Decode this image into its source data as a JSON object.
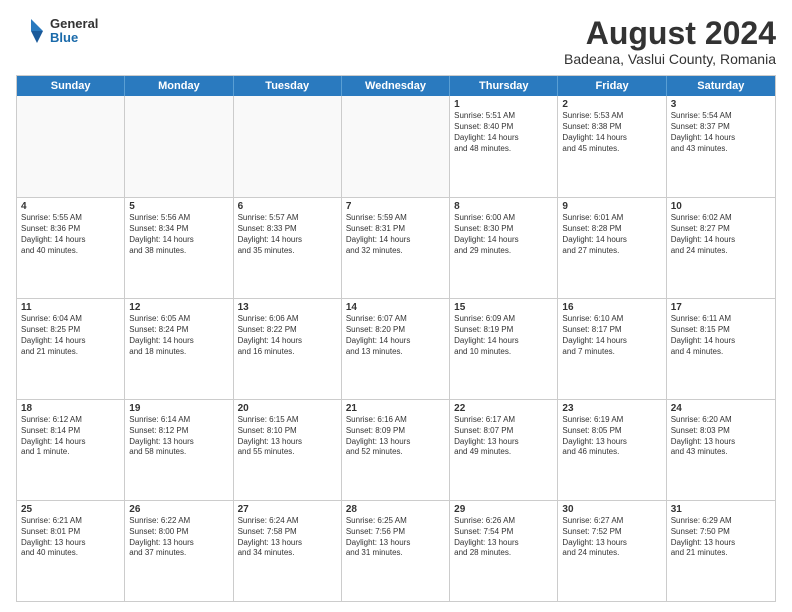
{
  "logo": {
    "general": "General",
    "blue": "Blue"
  },
  "title": "August 2024",
  "subtitle": "Badeana, Vaslui County, Romania",
  "header_days": [
    "Sunday",
    "Monday",
    "Tuesday",
    "Wednesday",
    "Thursday",
    "Friday",
    "Saturday"
  ],
  "weeks": [
    [
      {
        "day": "",
        "text": ""
      },
      {
        "day": "",
        "text": ""
      },
      {
        "day": "",
        "text": ""
      },
      {
        "day": "",
        "text": ""
      },
      {
        "day": "1",
        "text": "Sunrise: 5:51 AM\nSunset: 8:40 PM\nDaylight: 14 hours\nand 48 minutes."
      },
      {
        "day": "2",
        "text": "Sunrise: 5:53 AM\nSunset: 8:38 PM\nDaylight: 14 hours\nand 45 minutes."
      },
      {
        "day": "3",
        "text": "Sunrise: 5:54 AM\nSunset: 8:37 PM\nDaylight: 14 hours\nand 43 minutes."
      }
    ],
    [
      {
        "day": "4",
        "text": "Sunrise: 5:55 AM\nSunset: 8:36 PM\nDaylight: 14 hours\nand 40 minutes."
      },
      {
        "day": "5",
        "text": "Sunrise: 5:56 AM\nSunset: 8:34 PM\nDaylight: 14 hours\nand 38 minutes."
      },
      {
        "day": "6",
        "text": "Sunrise: 5:57 AM\nSunset: 8:33 PM\nDaylight: 14 hours\nand 35 minutes."
      },
      {
        "day": "7",
        "text": "Sunrise: 5:59 AM\nSunset: 8:31 PM\nDaylight: 14 hours\nand 32 minutes."
      },
      {
        "day": "8",
        "text": "Sunrise: 6:00 AM\nSunset: 8:30 PM\nDaylight: 14 hours\nand 29 minutes."
      },
      {
        "day": "9",
        "text": "Sunrise: 6:01 AM\nSunset: 8:28 PM\nDaylight: 14 hours\nand 27 minutes."
      },
      {
        "day": "10",
        "text": "Sunrise: 6:02 AM\nSunset: 8:27 PM\nDaylight: 14 hours\nand 24 minutes."
      }
    ],
    [
      {
        "day": "11",
        "text": "Sunrise: 6:04 AM\nSunset: 8:25 PM\nDaylight: 14 hours\nand 21 minutes."
      },
      {
        "day": "12",
        "text": "Sunrise: 6:05 AM\nSunset: 8:24 PM\nDaylight: 14 hours\nand 18 minutes."
      },
      {
        "day": "13",
        "text": "Sunrise: 6:06 AM\nSunset: 8:22 PM\nDaylight: 14 hours\nand 16 minutes."
      },
      {
        "day": "14",
        "text": "Sunrise: 6:07 AM\nSunset: 8:20 PM\nDaylight: 14 hours\nand 13 minutes."
      },
      {
        "day": "15",
        "text": "Sunrise: 6:09 AM\nSunset: 8:19 PM\nDaylight: 14 hours\nand 10 minutes."
      },
      {
        "day": "16",
        "text": "Sunrise: 6:10 AM\nSunset: 8:17 PM\nDaylight: 14 hours\nand 7 minutes."
      },
      {
        "day": "17",
        "text": "Sunrise: 6:11 AM\nSunset: 8:15 PM\nDaylight: 14 hours\nand 4 minutes."
      }
    ],
    [
      {
        "day": "18",
        "text": "Sunrise: 6:12 AM\nSunset: 8:14 PM\nDaylight: 14 hours\nand 1 minute."
      },
      {
        "day": "19",
        "text": "Sunrise: 6:14 AM\nSunset: 8:12 PM\nDaylight: 13 hours\nand 58 minutes."
      },
      {
        "day": "20",
        "text": "Sunrise: 6:15 AM\nSunset: 8:10 PM\nDaylight: 13 hours\nand 55 minutes."
      },
      {
        "day": "21",
        "text": "Sunrise: 6:16 AM\nSunset: 8:09 PM\nDaylight: 13 hours\nand 52 minutes."
      },
      {
        "day": "22",
        "text": "Sunrise: 6:17 AM\nSunset: 8:07 PM\nDaylight: 13 hours\nand 49 minutes."
      },
      {
        "day": "23",
        "text": "Sunrise: 6:19 AM\nSunset: 8:05 PM\nDaylight: 13 hours\nand 46 minutes."
      },
      {
        "day": "24",
        "text": "Sunrise: 6:20 AM\nSunset: 8:03 PM\nDaylight: 13 hours\nand 43 minutes."
      }
    ],
    [
      {
        "day": "25",
        "text": "Sunrise: 6:21 AM\nSunset: 8:01 PM\nDaylight: 13 hours\nand 40 minutes."
      },
      {
        "day": "26",
        "text": "Sunrise: 6:22 AM\nSunset: 8:00 PM\nDaylight: 13 hours\nand 37 minutes."
      },
      {
        "day": "27",
        "text": "Sunrise: 6:24 AM\nSunset: 7:58 PM\nDaylight: 13 hours\nand 34 minutes."
      },
      {
        "day": "28",
        "text": "Sunrise: 6:25 AM\nSunset: 7:56 PM\nDaylight: 13 hours\nand 31 minutes."
      },
      {
        "day": "29",
        "text": "Sunrise: 6:26 AM\nSunset: 7:54 PM\nDaylight: 13 hours\nand 28 minutes."
      },
      {
        "day": "30",
        "text": "Sunrise: 6:27 AM\nSunset: 7:52 PM\nDaylight: 13 hours\nand 24 minutes."
      },
      {
        "day": "31",
        "text": "Sunrise: 6:29 AM\nSunset: 7:50 PM\nDaylight: 13 hours\nand 21 minutes."
      }
    ]
  ]
}
